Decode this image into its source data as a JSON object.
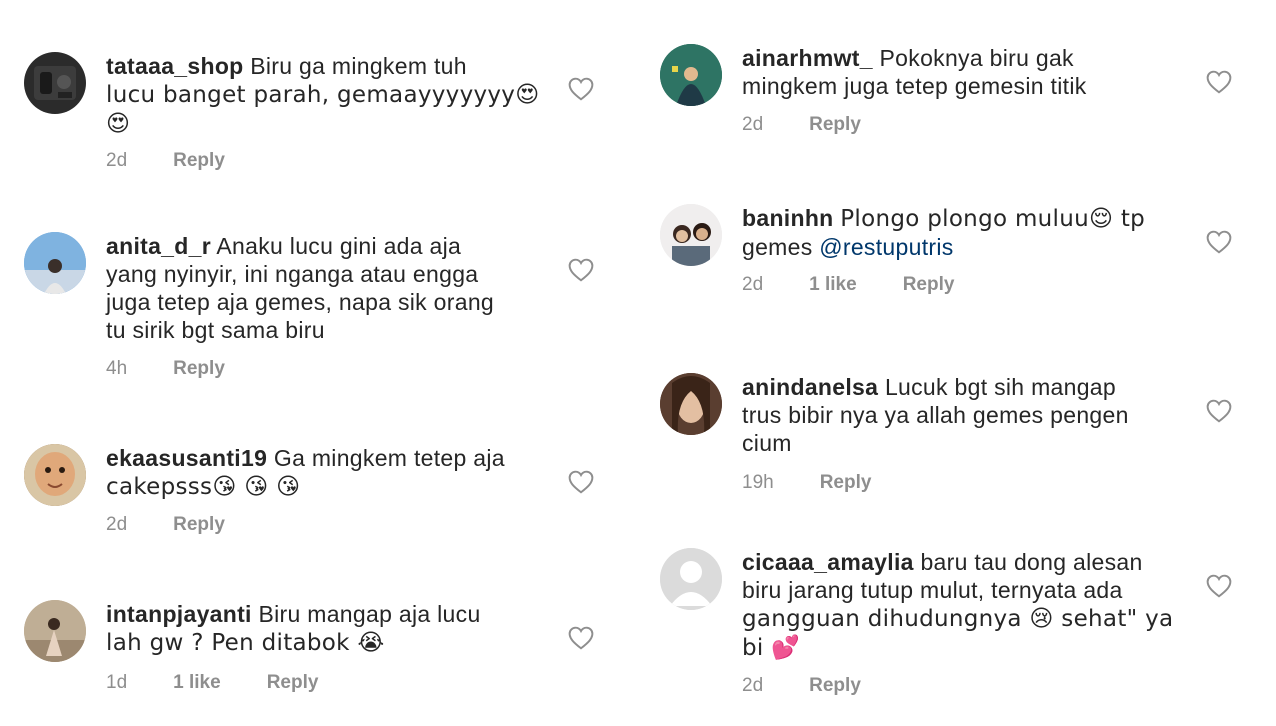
{
  "left_comments": [
    {
      "user": "tataaa_shop",
      "text_lines": [
        "Biru ga mingkem tuh",
        "lucu banget parah, gemaayyyyyyy😍",
        "😍"
      ],
      "time": "2d",
      "likes": "",
      "reply": "Reply"
    },
    {
      "user": "anita_d_r",
      "text_lines": [
        "Anaku lucu gini ada aja",
        "yang nyinyir, ini nganga atau engga",
        "juga tetep aja gemes, napa sik orang",
        "tu sirik bgt sama biru"
      ],
      "time": "4h",
      "likes": "",
      "reply": "Reply"
    },
    {
      "user": "ekaasusanti19",
      "text_lines": [
        "Ga mingkem tetep aja",
        "cakepsss😘 😘 😘"
      ],
      "time": "2d",
      "likes": "",
      "reply": "Reply"
    },
    {
      "user": "intanpjayanti",
      "text_lines": [
        "Biru mangap aja lucu",
        "lah gw ? Pen ditabok 😭"
      ],
      "time": "1d",
      "likes": "1 like",
      "reply": "Reply"
    }
  ],
  "right_comments": [
    {
      "user": "ainarhmwt_",
      "text_lines": [
        "Pokoknya biru gak",
        "mingkem juga tetep gemesin titik"
      ],
      "time": "2d",
      "likes": "",
      "reply": "Reply"
    },
    {
      "user": "baninhn",
      "text_lines": [
        "Plongo plongo muluu😌 tp",
        "gemes "
      ],
      "mention": "@restuputris",
      "time": "2d",
      "likes": "1 like",
      "reply": "Reply"
    },
    {
      "user": "anindanelsa",
      "text_lines": [
        "Lucuk bgt sih mangap",
        "trus bibir nya ya allah gemes pengen",
        "cium"
      ],
      "time": "19h",
      "likes": "",
      "reply": "Reply"
    },
    {
      "user": "cicaaa_amaylia",
      "text_lines": [
        "baru tau dong alesan",
        "biru jarang tutup mulut, ternyata ada",
        "gangguan dihudungnya 😢 sehat\" ya",
        "bi 💕"
      ],
      "time": "2d",
      "likes": "",
      "reply": "Reply"
    }
  ],
  "colors": {
    "text": "#262626",
    "meta": "#8e8e8e",
    "mention": "#00376b",
    "heart": "#8e8e8e"
  },
  "icons": [
    "heart-outline-icon",
    "avatar-image"
  ]
}
